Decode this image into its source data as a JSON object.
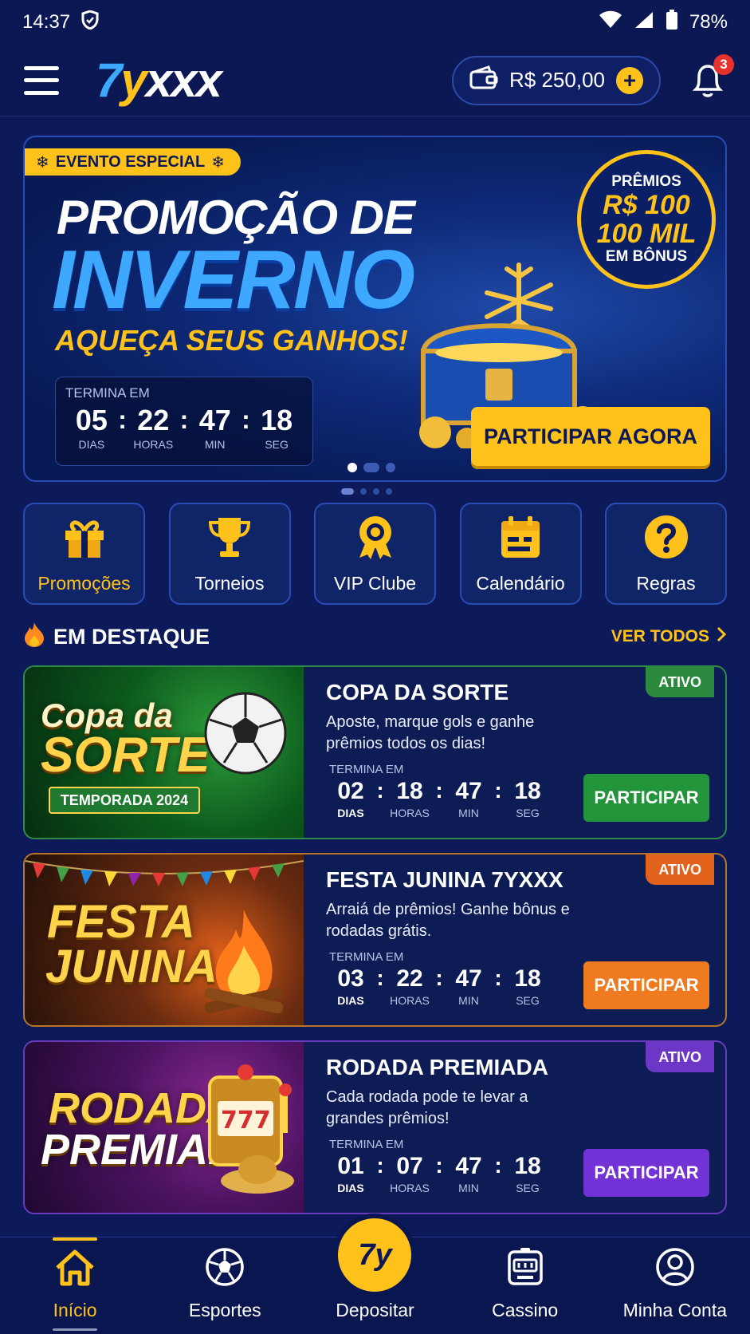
{
  "status_bar": {
    "time": "14:37",
    "battery": "78%"
  },
  "header": {
    "logo": {
      "seven": "7",
      "y": "y",
      "rest": "xxx"
    },
    "balance": "R$ 250,00",
    "notification_count": "3"
  },
  "hero": {
    "tag": "EVENTO ESPECIAL",
    "title_line1": "PROMOÇÃO DE",
    "title_line2": "INVERNO",
    "title_line3": "AQUEÇA SEUS GANHOS!",
    "countdown_label": "TERMINA EM",
    "countdown": {
      "days": "05",
      "hours": "22",
      "min": "47",
      "sec": "18",
      "days_label": "DIAS",
      "hours_label": "HORAS",
      "min_label": "MIN",
      "sec_label": "SEG"
    },
    "prize": {
      "label_top": "PRÊMIOS",
      "amount_line1": "R$ 100",
      "amount_line2": "100 MIL",
      "label_bottom": "EM BÔNUS"
    },
    "cta": "PARTICIPAR AGORA"
  },
  "quick_links": [
    {
      "label": "Promoções",
      "icon": "gift-icon"
    },
    {
      "label": "Torneios",
      "icon": "trophy-icon"
    },
    {
      "label": "VIP Clube",
      "icon": "medal-icon"
    },
    {
      "label": "Calendário",
      "icon": "calendar-icon"
    },
    {
      "label": "Regras",
      "icon": "help-icon"
    }
  ],
  "featured": {
    "title": "EM DESTAQUE",
    "see_all": "VER TODOS"
  },
  "events": [
    {
      "art_line1": "Copa da",
      "art_line2": "SORTE",
      "art_sub": "TEMPORADA 2024",
      "title": "COPA DA SORTE",
      "desc": "Aposte, marque gols e ganhe prêmios todos os dias!",
      "status": "ATIVO",
      "cd_label": "TERMINA EM",
      "days": "02",
      "hours": "18",
      "min": "47",
      "sec": "18",
      "button": "PARTICIPAR",
      "color": "#22943a"
    },
    {
      "art_line1": "FESTA",
      "art_line2": "JUNINA",
      "art_sub": "",
      "title": "FESTA JUNINA 7YXXX",
      "desc": "Arraiá de prêmios! Ganhe bônus e rodadas grátis.",
      "status": "ATIVO",
      "cd_label": "TERMINA EM",
      "days": "03",
      "hours": "22",
      "min": "47",
      "sec": "18",
      "button": "PARTICIPAR",
      "color": "#f07a20"
    },
    {
      "art_line1": "RODADA",
      "art_line2": "PREMIADA",
      "art_sub": "",
      "title": "RODADA PREMIADA",
      "desc": "Cada rodada pode te levar a grandes prêmios!",
      "status": "ATIVO",
      "cd_label": "TERMINA EM",
      "days": "01",
      "hours": "07",
      "min": "47",
      "sec": "18",
      "button": "PARTICIPAR",
      "color": "#7232d6"
    }
  ],
  "cd_labels": {
    "days": "DIAS",
    "hours": "HORAS",
    "min": "MIN",
    "sec": "SEG"
  },
  "bottom_nav": [
    {
      "label": "Início",
      "icon": "home-icon"
    },
    {
      "label": "Esportes",
      "icon": "soccer-ball-icon"
    },
    {
      "label": "Depositar",
      "icon": "deposit-logo-icon",
      "logo_text": "7y"
    },
    {
      "label": "Cassino",
      "icon": "slot-machine-icon"
    },
    {
      "label": "Minha Conta",
      "icon": "user-icon"
    }
  ]
}
